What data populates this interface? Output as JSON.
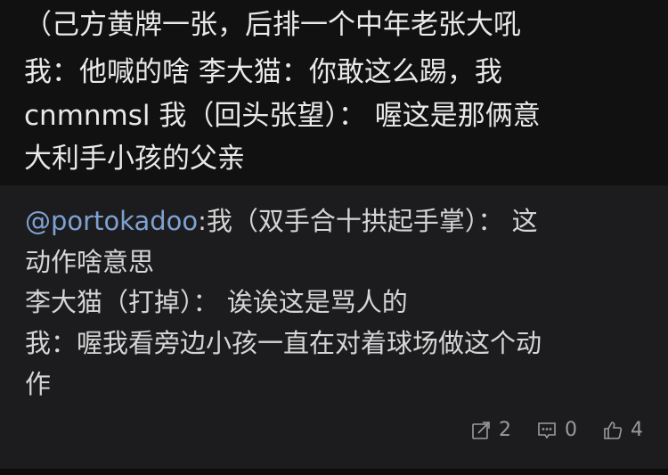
{
  "post": {
    "lines": [
      "（己方黄牌一张，后排一个中年老张大吼",
      "我：他喊的啥 李大猫：你敢这么踢，我",
      "cnmnmsl 我（回头张望）： 喔这是那俩意",
      "大利手小孩的父亲"
    ]
  },
  "comment": {
    "mention": "@portokadoo",
    "line1_rest": ":我（双手合十拱起手掌）： 这",
    "line2": "动作啥意思",
    "line3": "李大猫（打掉）： 诶诶这是骂人的",
    "line4": "我：喔我看旁边小孩一直在对着球场做这个动",
    "line5": "作"
  },
  "actions": {
    "share_count": "2",
    "comment_count": "0",
    "like_count": "4"
  },
  "icons": {
    "share": "share-icon",
    "comment": "comment-icon",
    "like": "thumbs-up-icon"
  }
}
